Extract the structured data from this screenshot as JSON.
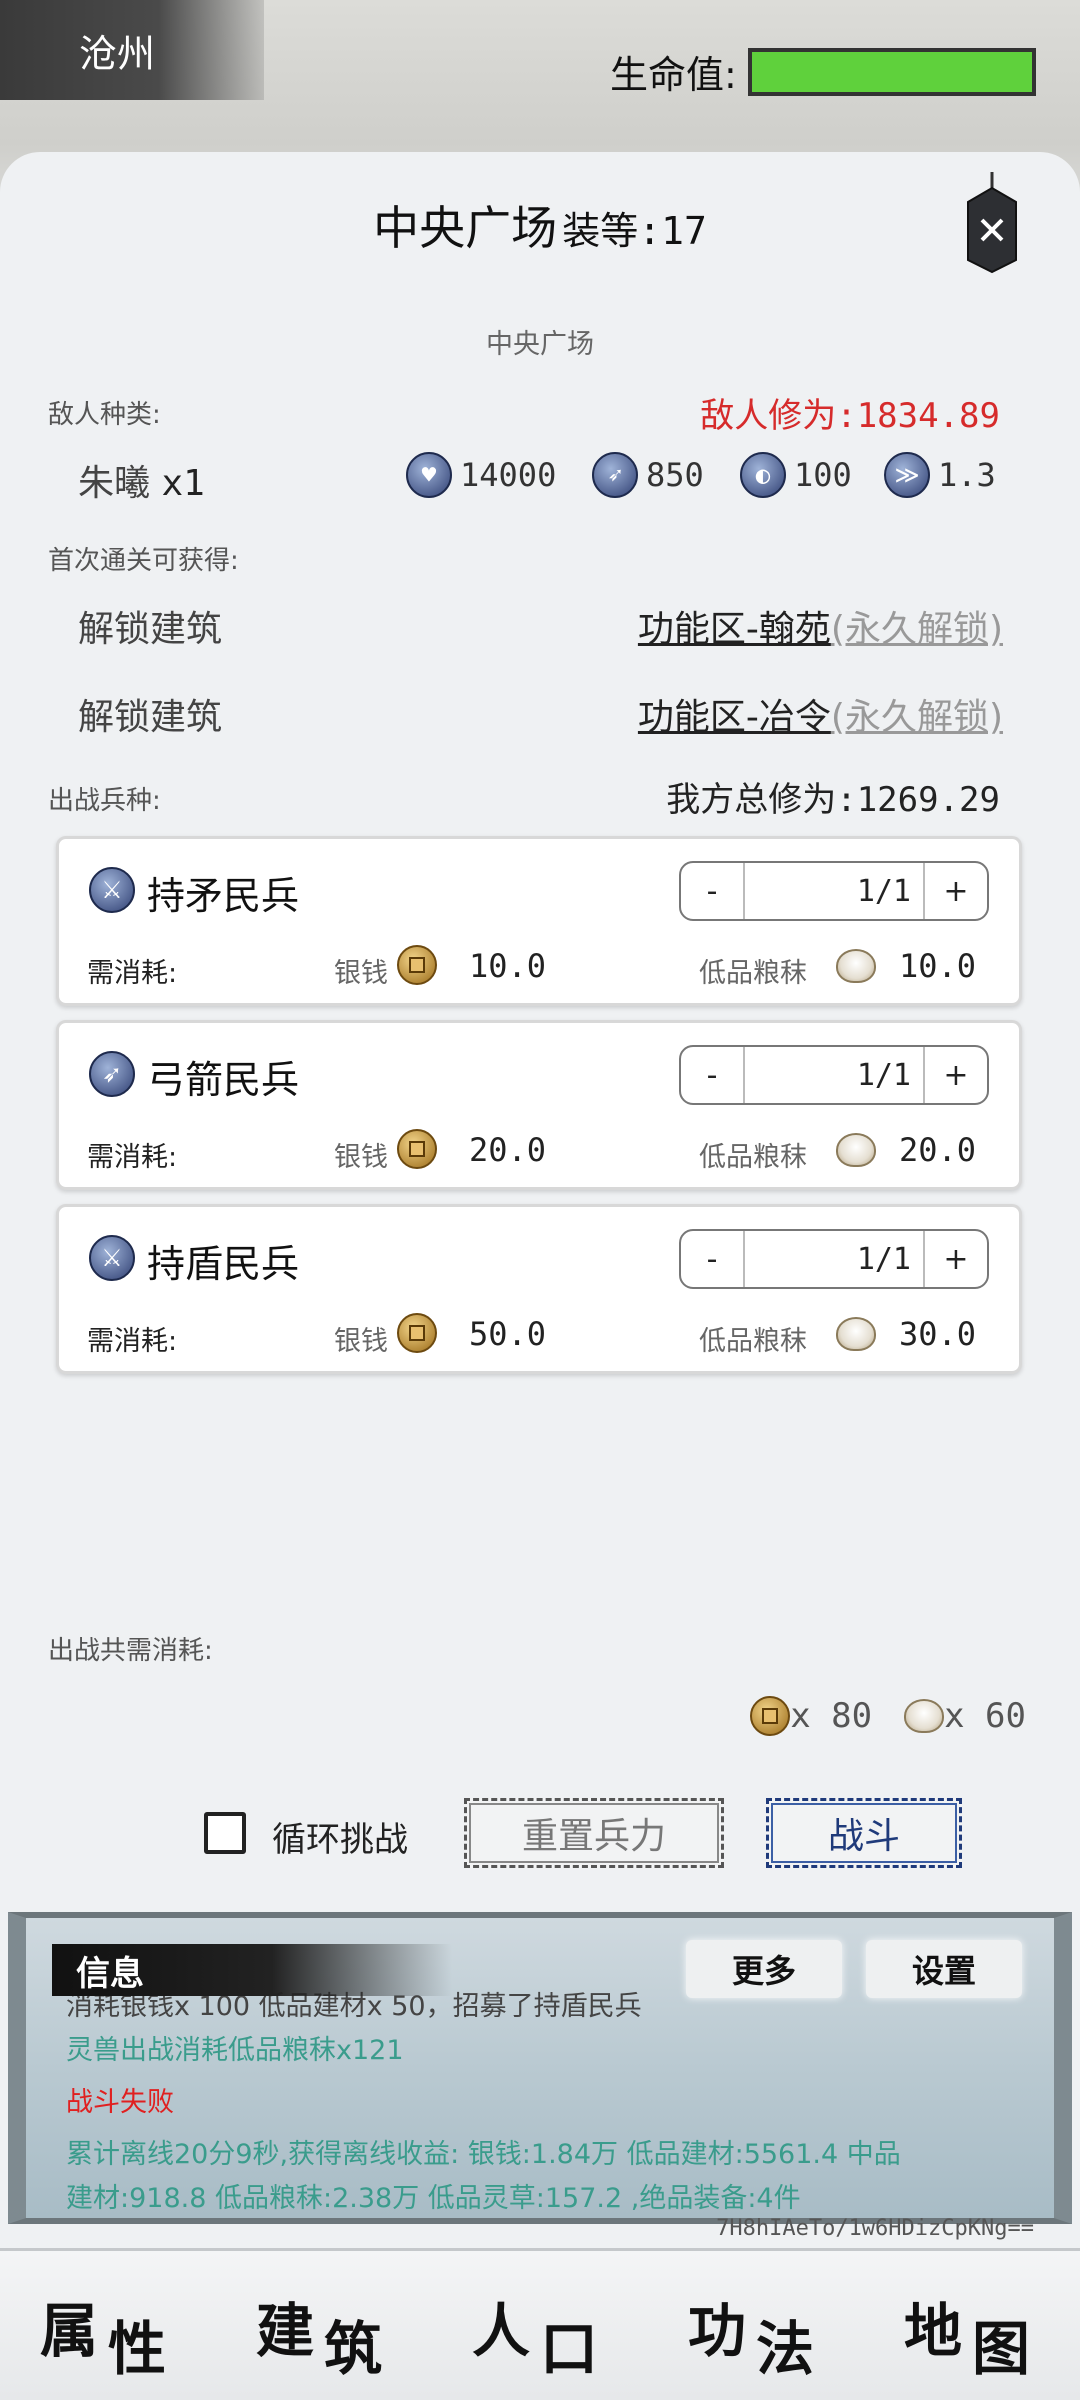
{
  "location": "沧州",
  "hp": {
    "label": "生命值:",
    "percent": 100,
    "color": "#5fd13c"
  },
  "stage": {
    "name": "中央广场",
    "level_label": "装等:17",
    "subtitle": "中央广场"
  },
  "enemy": {
    "section_label": "敌人种类:",
    "power_label": "敌人修为:1834.89",
    "name": "朱曦",
    "count": "x1",
    "stats": [
      {
        "icon": "heart-icon",
        "value": "14000"
      },
      {
        "icon": "bow-icon",
        "value": "850"
      },
      {
        "icon": "shield-icon",
        "value": "100"
      },
      {
        "icon": "speed-icon",
        "value": "1.3"
      }
    ]
  },
  "rewards": {
    "section_label": "首次通关可获得:",
    "items": [
      {
        "label": "解锁建筑",
        "target": "功能区-翰苑",
        "note": "(永久解锁)"
      },
      {
        "label": "解锁建筑",
        "target": "功能区-冶令",
        "note": "(永久解锁)"
      }
    ]
  },
  "units": {
    "section_label": "出战兵种:",
    "our_power_label": "我方总修为:1269.29",
    "list": [
      {
        "name": "持矛民兵",
        "icon": "spear-icon",
        "count": "1/1",
        "need": "需消耗:",
        "cost1_label": "银钱",
        "cost1": "10.0",
        "cost2_label": "低品粮秣",
        "cost2": "10.0"
      },
      {
        "name": "弓箭民兵",
        "icon": "bow-icon",
        "count": "1/1",
        "need": "需消耗:",
        "cost1_label": "银钱",
        "cost1": "20.0",
        "cost2_label": "低品粮秣",
        "cost2": "20.0"
      },
      {
        "name": "持盾民兵",
        "icon": "shield-unit-icon",
        "count": "1/1",
        "need": "需消耗:",
        "cost1_label": "银钱",
        "cost1": "50.0",
        "cost2_label": "低品粮秣",
        "cost2": "30.0"
      }
    ],
    "minus": "-",
    "plus": "+"
  },
  "total_cost": {
    "label": "出战共需消耗:",
    "coin": "x 80",
    "rice": "x 60"
  },
  "actions": {
    "loop_label": "循环挑战",
    "reset_label": "重置兵力",
    "fight_label": "战斗"
  },
  "messages": {
    "title": "信息",
    "more": "更多",
    "settings": "设置",
    "lines": [
      "消耗银钱x 100 低品建材x 50，招募了持盾民兵",
      "灵兽出战消耗低品粮秣x121",
      "战斗失败",
      "累计离线20分9秒,获得离线收益: 银钱:1.84万 低品建材:5561.4 中品",
      "建材:918.8 低品粮秣:2.38万 低品灵草:157.2 ,绝品装备:4件"
    ]
  },
  "token": "7H8hIAeTo/1w6HDizCpKNg==",
  "nav": [
    {
      "a": "属",
      "b": "性"
    },
    {
      "a": "建",
      "b": "筑"
    },
    {
      "a": "人",
      "b": "口"
    },
    {
      "a": "功",
      "b": "法"
    },
    {
      "a": "地",
      "b": "图"
    }
  ]
}
